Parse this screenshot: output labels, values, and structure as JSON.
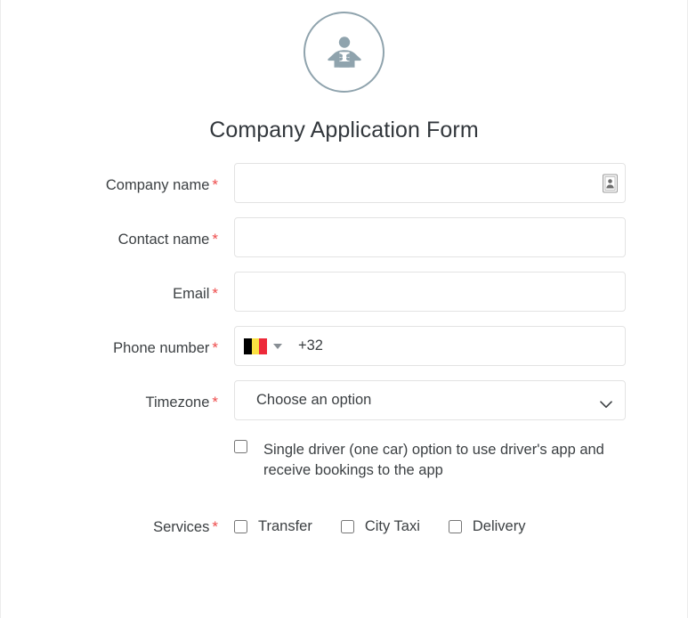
{
  "page": {
    "logo_icon": "person-with-package-icon",
    "title": "Company Application Form"
  },
  "colors": {
    "required_asterisk": "#ee4b4b",
    "logo_stroke": "#8fa3ad",
    "input_border": "#e3e3e3",
    "text": "#3c4043",
    "flag_black": "#000000",
    "flag_yellow": "#fae042",
    "flag_red": "#ed2939"
  },
  "form": {
    "fields": [
      {
        "name": "company-name",
        "label": "Company name",
        "required": true,
        "required_marker": "*",
        "type": "text",
        "value": "",
        "placeholder": "",
        "trailing_icon": "autofill-contact-card-icon"
      },
      {
        "name": "contact-name",
        "label": "Contact name",
        "required": true,
        "required_marker": "*",
        "type": "text",
        "value": "",
        "placeholder": ""
      },
      {
        "name": "email",
        "label": "Email",
        "required": true,
        "required_marker": "*",
        "type": "text",
        "value": "",
        "placeholder": ""
      }
    ],
    "phone": {
      "label": "Phone number",
      "required_marker": "*",
      "country_flag": "belgium-flag-icon",
      "dial_code": "+32",
      "value": "",
      "dropdown_icon": "chevron-down-icon"
    },
    "timezone": {
      "label": "Timezone",
      "required_marker": "*",
      "selected": "Choose an option",
      "dropdown_icon": "chevron-down-icon"
    },
    "single_driver": {
      "checked": false,
      "text": "Single driver (one car) option to use driver's app and receive bookings to the app"
    },
    "services": {
      "label": "Services",
      "required_marker": "*",
      "options": [
        {
          "name": "transfer",
          "label": "Transfer",
          "checked": false
        },
        {
          "name": "city-taxi",
          "label": "City Taxi",
          "checked": false
        },
        {
          "name": "delivery",
          "label": "Delivery",
          "checked": false
        }
      ]
    }
  }
}
